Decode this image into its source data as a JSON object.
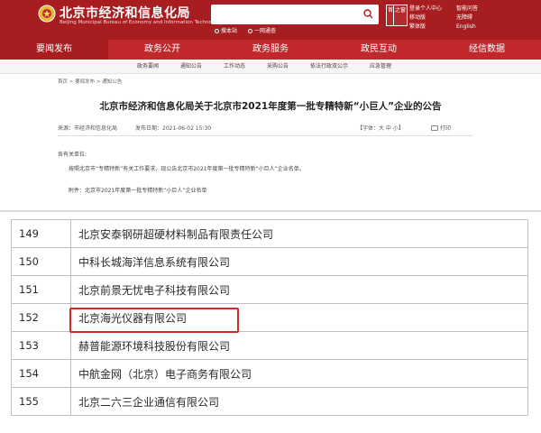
{
  "header": {
    "title": "北京市经济和信息化局",
    "subtitle": "Beijing Municipal Bureau of Economy and Information Technology",
    "search_scopes": [
      "搜本站",
      "一网通查"
    ],
    "seal_left": "首都",
    "seal_right": "之窗",
    "top_links_1": [
      "登录个人中心",
      "移动版",
      "繁体版"
    ],
    "top_links_2": [
      "智能问答",
      "无障碍",
      "English"
    ]
  },
  "main_nav": [
    {
      "label": "要闻发布",
      "active": true
    },
    {
      "label": "政务公开",
      "active": false
    },
    {
      "label": "政务服务",
      "active": false
    },
    {
      "label": "政民互动",
      "active": false
    },
    {
      "label": "经信数据",
      "active": false
    }
  ],
  "sub_nav": [
    "政务要闻",
    "通知公告",
    "工作动态",
    "采购公告",
    "依法行政双公示",
    "应急管理"
  ],
  "breadcrumb": "首页 > 要闻发布 > 通知公告",
  "article": {
    "title": "北京市经济和信息化局关于北京市2021年度第一批专精特新“小巨人”企业的公告",
    "source_label": "来源：",
    "source": "市经济和信息化局",
    "date_label": "发布日期：",
    "date": "2021-06-02 15:30",
    "font_size_label": "【字体：大 中 小】",
    "print_label": "打印",
    "greeting": "各有关单位:",
    "paragraph": "按照北京市“专精特新”有关工作要求，现公告北京市2021年度第一批专精特新“小巨人”企业名单。",
    "attachment": "附件：北京市2021年度第一批专精特新“小巨人”企业名单"
  },
  "table": {
    "rows": [
      {
        "num": "149",
        "name": "北京安泰钢研超硬材料制品有限责任公司"
      },
      {
        "num": "150",
        "name": "中科长城海洋信息系统有限公司"
      },
      {
        "num": "151",
        "name": "北京前景无忧电子科技有限公司"
      },
      {
        "num": "152",
        "name": "北京海光仪器有限公司",
        "highlighted": true
      },
      {
        "num": "153",
        "name": "赫普能源环境科技股份有限公司"
      },
      {
        "num": "154",
        "name": "中航金网（北京）电子商务有限公司"
      },
      {
        "num": "155",
        "name": "北京二六三企业通信有限公司"
      }
    ]
  },
  "colors": {
    "brand_red": "#a81d20",
    "nav_red": "#c0282c",
    "highlight_red": "#d42a2a"
  },
  "icons": [
    "search-icon",
    "print-icon",
    "emblem-icon"
  ]
}
